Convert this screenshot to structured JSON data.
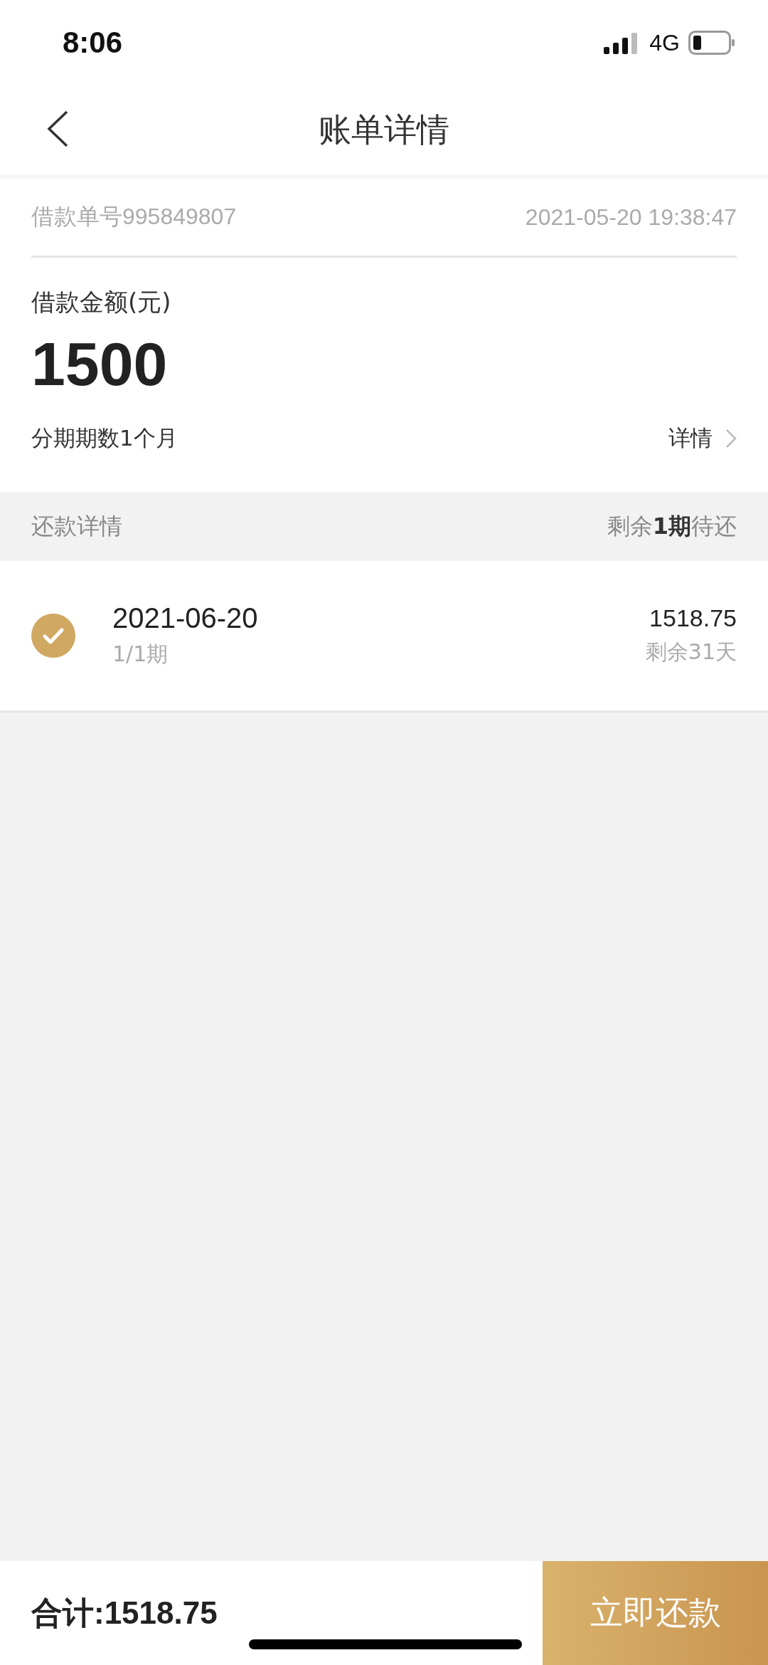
{
  "status_bar": {
    "time": "8:06",
    "network": "4G"
  },
  "nav": {
    "title": "账单详情"
  },
  "loan": {
    "number": "借款单号995849807",
    "datetime": "2021-05-20 19:38:47",
    "amount_label": "借款金额(元)",
    "amount": "1500",
    "term": "分期期数1个月",
    "details_link": "详情"
  },
  "repayment": {
    "title": "还款详情",
    "remaining": "剩余**1期**待还",
    "items": [
      {
        "date": "2021-06-20",
        "period": "1/1期",
        "amount": "1518.75",
        "days_left": "剩余31天",
        "checked": true
      }
    ]
  },
  "footer": {
    "total": "合计:1518.75",
    "button": "立即还款"
  }
}
